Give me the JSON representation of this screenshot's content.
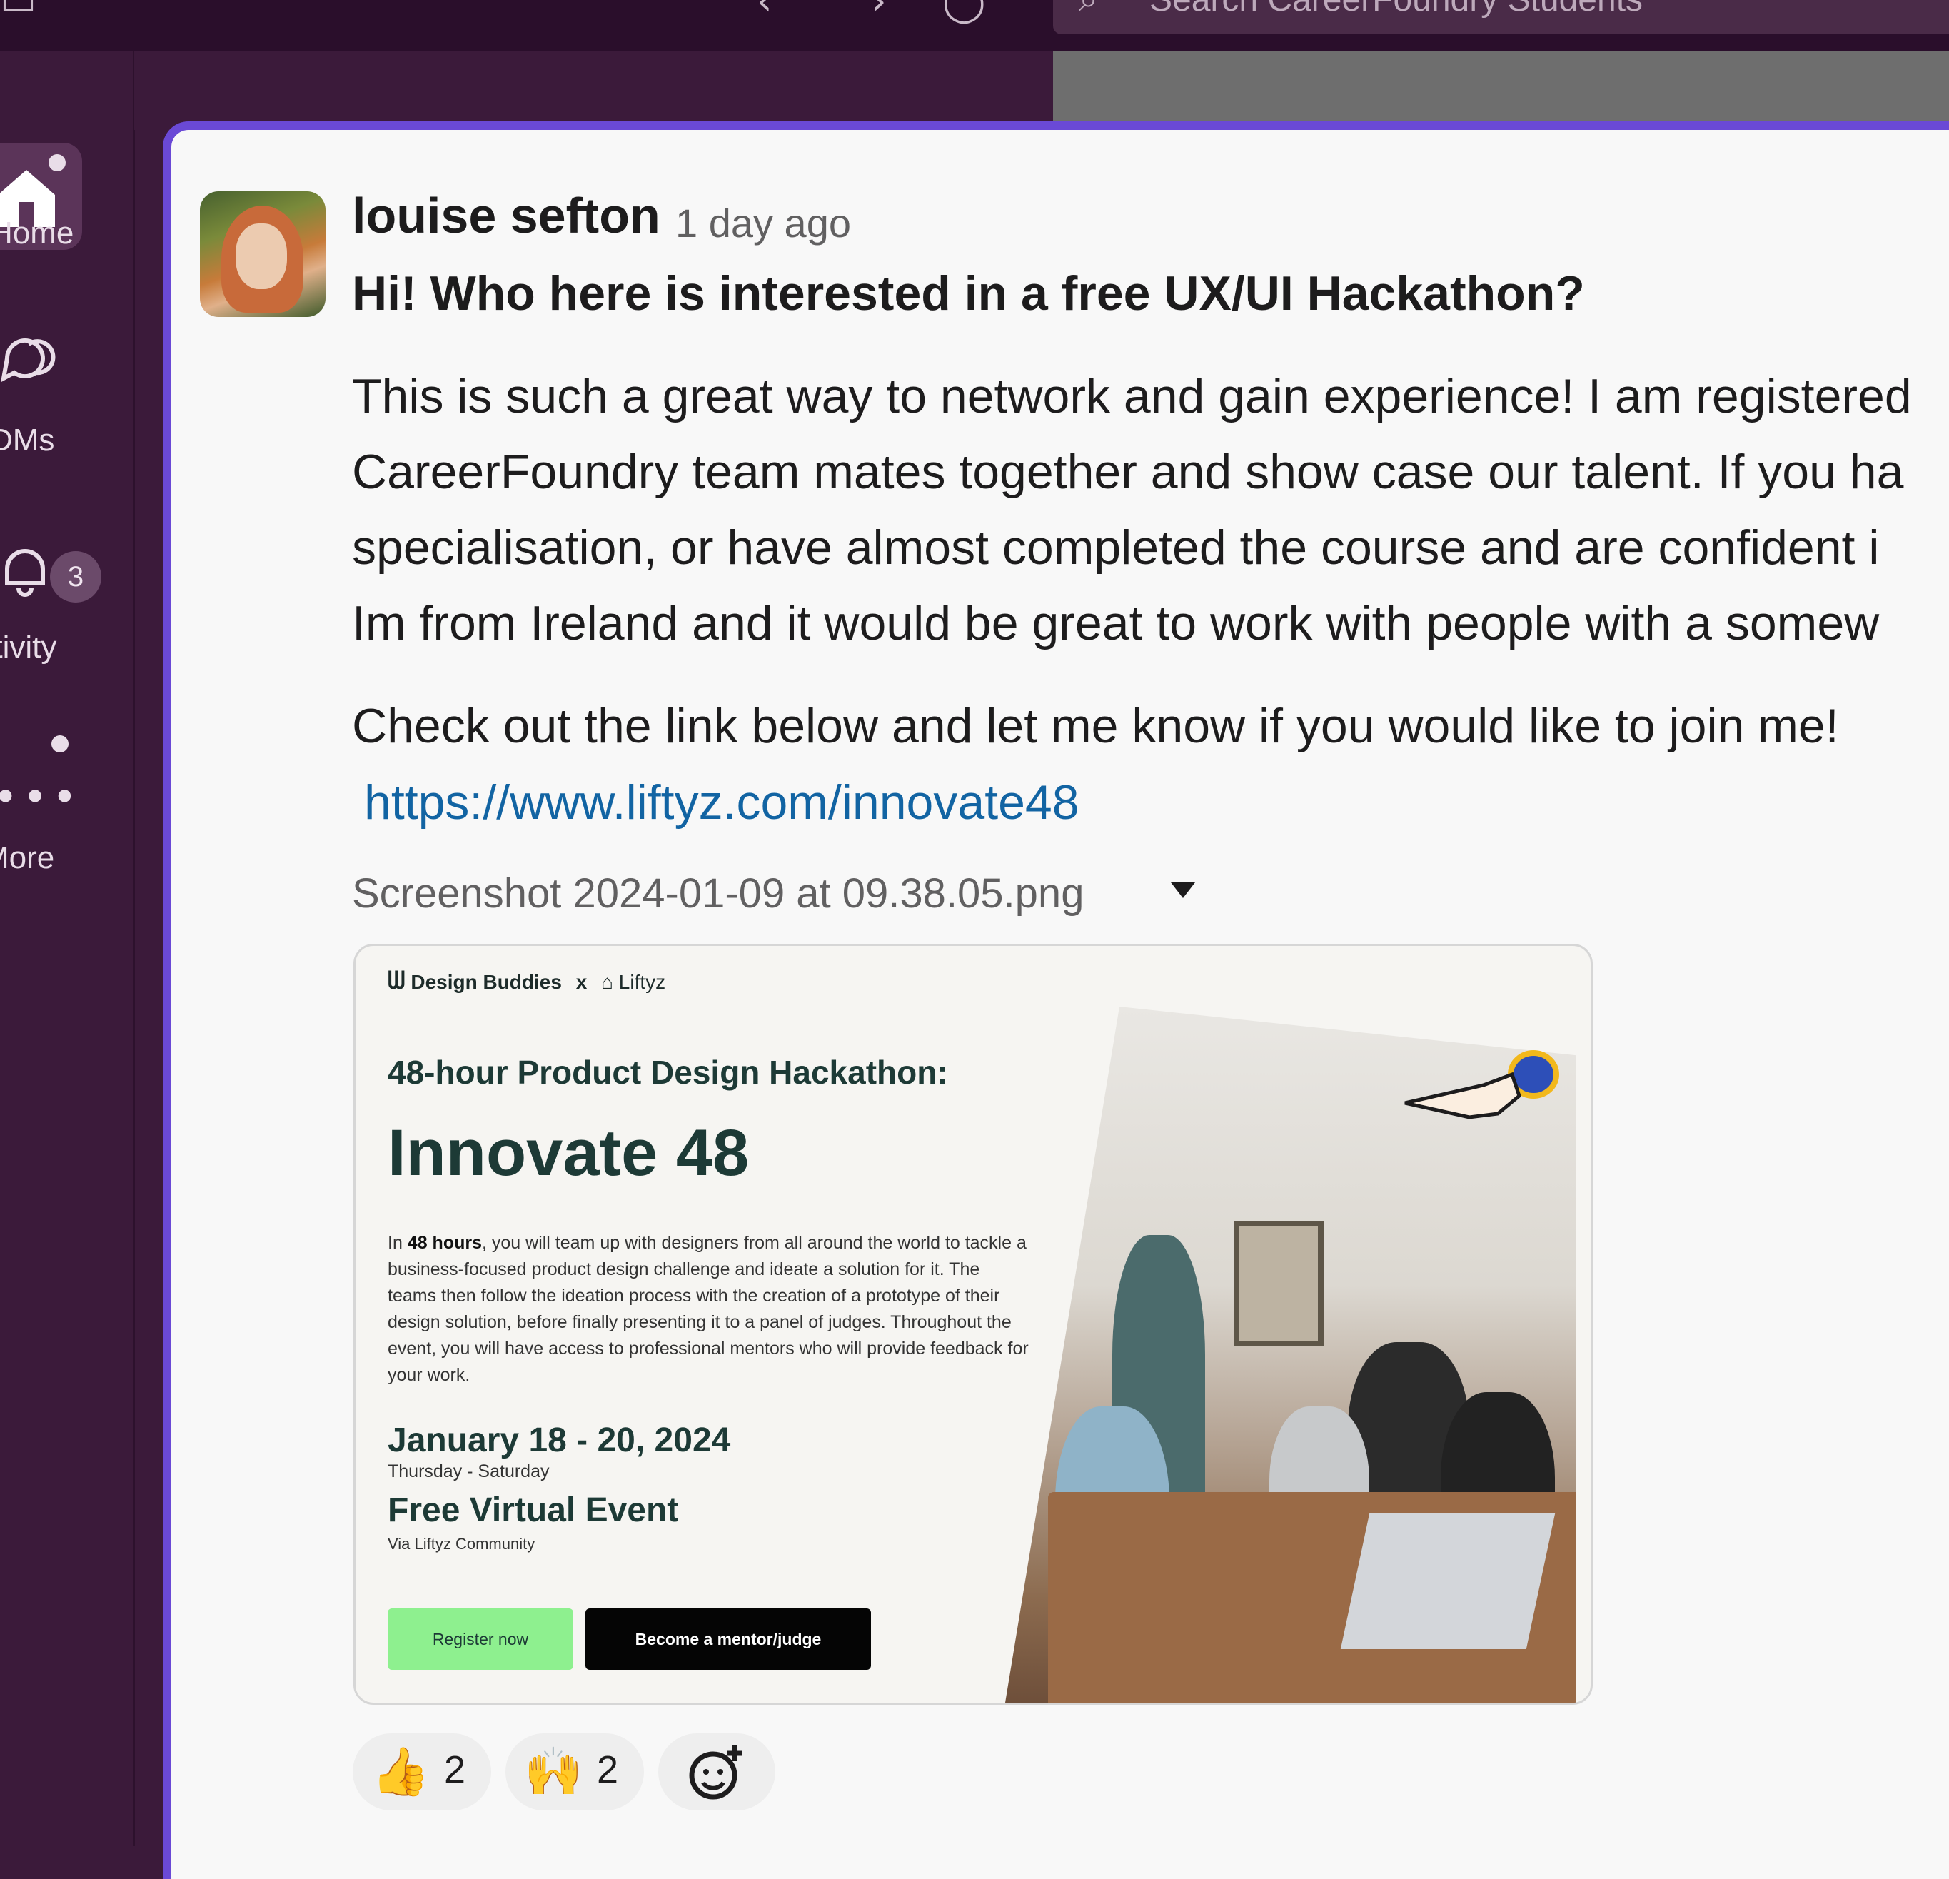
{
  "top_bar": {
    "search_placeholder": "Search CareerFoundry Students"
  },
  "rail": {
    "items": [
      {
        "label": "Home",
        "icon": "home-icon"
      },
      {
        "label": "DMs",
        "icon": "dm-icon"
      },
      {
        "label": "Activity",
        "icon": "bell-icon",
        "badge": "3"
      },
      {
        "label": "More",
        "icon": "more-icon"
      }
    ]
  },
  "message": {
    "author": "louise sefton",
    "timestamp": "1 day ago",
    "headline": "Hi! Who here is interested in a free UX/UI Hackathon?",
    "body_lines": [
      "This is such a great way to network and gain experience! I am registered",
      "CareerFoundry team mates together and show case our talent. If you ha",
      "specialisation, or have almost completed the course and are confident i",
      "Im from Ireland and it would be great to work with people with a somew"
    ],
    "cta": "Check out the link below and let me know if you would like to join me!",
    "link": "https://www.liftyz.com/innovate48",
    "attachment_name": "Screenshot 2024-01-09 at 09.38.05.png"
  },
  "attachment": {
    "brand_left": "Design Buddies",
    "brand_sep": "x",
    "brand_right": "Liftyz",
    "subtitle": "48-hour Product Design Hackathon:",
    "title": "Innovate 48",
    "desc_bold": "48 hours",
    "desc_pre": "In ",
    "desc_post": ", you will team up with designers from all around the world to tackle a business-focused product design challenge and ideate a solution for it. The teams then follow the ideation process with the creation of a prototype of their design solution, before finally presenting it to a panel of judges. Throughout the event, you will have access to professional mentors who will provide feedback for your work.",
    "date": "January 18 - 20, 2024",
    "days": "Thursday - Saturday",
    "event": "Free Virtual Event",
    "via": "Via Liftyz Community",
    "register_label": "Register now",
    "mentor_label": "Become a mentor/judge"
  },
  "reactions": [
    {
      "emoji": "👍",
      "count": "2"
    },
    {
      "emoji": "🙌",
      "count": "2"
    }
  ],
  "colors": {
    "sidebar": "#3b1a3a",
    "accent_border": "#6a49d6",
    "link": "#1264a3",
    "register_button": "#8ef08f"
  }
}
